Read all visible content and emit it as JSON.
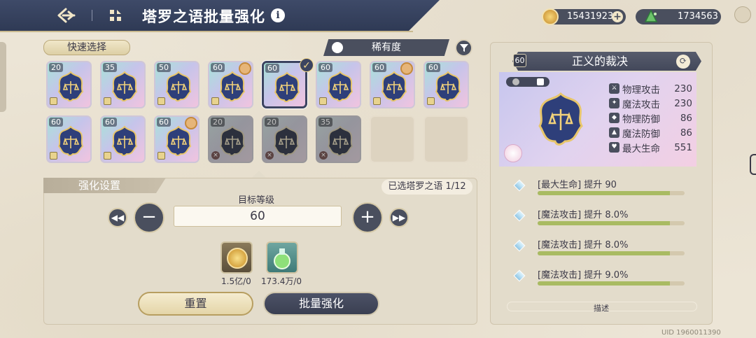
{
  "header": {
    "title": "塔罗之语批量强化",
    "info_icon": "i",
    "gold_value": "154319232",
    "gem_value": "1734563"
  },
  "filters": {
    "quick_select_label": "快速选择",
    "rarity_label": "稀有度"
  },
  "cards_row1": [
    {
      "level": "20",
      "state": "locked"
    },
    {
      "level": "35",
      "state": "locked"
    },
    {
      "level": "50",
      "state": "locked"
    },
    {
      "level": "60",
      "state": "locked",
      "avatar": true
    },
    {
      "level": "60",
      "state": "selected"
    },
    {
      "level": "60",
      "state": "locked"
    },
    {
      "level": "60",
      "state": "locked",
      "avatar": true
    },
    {
      "level": "60",
      "state": "locked"
    }
  ],
  "cards_row2": [
    {
      "level": "60",
      "state": "locked"
    },
    {
      "level": "60",
      "state": "locked"
    },
    {
      "level": "60",
      "state": "locked",
      "avatar": true
    },
    {
      "level": "20",
      "state": "disabled"
    },
    {
      "level": "20",
      "state": "disabled"
    },
    {
      "level": "35",
      "state": "disabled"
    }
  ],
  "settings": {
    "header": "强化设置",
    "selected_count": "已选塔罗之语 1/12",
    "target_label": "目标等级",
    "target_value": "60",
    "cost_gold": "1.5亿/0",
    "cost_potion": "173.4万/0",
    "reset_label": "重置",
    "batch_label": "批量强化"
  },
  "detail": {
    "level": "60",
    "name": "正义的裁决",
    "stats": [
      {
        "icon": "sword-icon",
        "name": "物理攻击",
        "value": "230"
      },
      {
        "icon": "wand-icon",
        "name": "魔法攻击",
        "value": "230"
      },
      {
        "icon": "shield-icon",
        "name": "物理防御",
        "value": "86"
      },
      {
        "icon": "hat-icon",
        "name": "魔法防御",
        "value": "86"
      },
      {
        "icon": "heart-icon",
        "name": "最大生命",
        "value": "551"
      }
    ],
    "bonuses": [
      {
        "text": "[最大生命] 提升 90",
        "progress": 0.9
      },
      {
        "text": "[魔法攻击] 提升 8.0%",
        "progress": 0.9
      },
      {
        "text": "[魔法攻击] 提升 8.0%",
        "progress": 0.9
      },
      {
        "text": "[魔法攻击] 提升 9.0%",
        "progress": 0.9
      }
    ],
    "desc_label": "描述"
  },
  "footer": {
    "uid": "UID 1960011390"
  },
  "colors": {
    "header_bg": "#2f3a55",
    "panel_bg": "#e3dccb",
    "accent_gold": "#c9b98e"
  }
}
